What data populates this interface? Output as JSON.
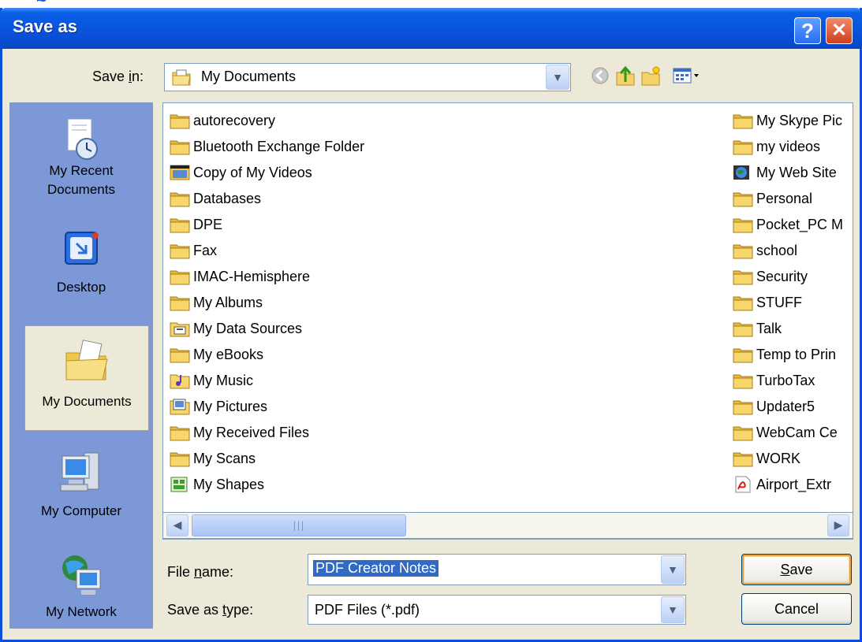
{
  "window": {
    "title": "Save as"
  },
  "toolbar": {
    "save_in_label": "Save in:",
    "save_in_value": "My Documents"
  },
  "places": [
    {
      "label": "My Recent Documents",
      "icon": "recent-documents-icon"
    },
    {
      "label": "Desktop",
      "icon": "desktop-icon"
    },
    {
      "label": "My Documents",
      "icon": "my-documents-icon",
      "selected": true
    },
    {
      "label": "My Computer",
      "icon": "my-computer-icon"
    },
    {
      "label": "My Network",
      "icon": "my-network-icon"
    }
  ],
  "files_col1": [
    {
      "name": "autorecovery",
      "icon": "folder"
    },
    {
      "name": "Bluetooth Exchange Folder",
      "icon": "folder"
    },
    {
      "name": "Copy of My Videos",
      "icon": "video-folder"
    },
    {
      "name": "Databases",
      "icon": "folder"
    },
    {
      "name": "DPE",
      "icon": "folder"
    },
    {
      "name": "Fax",
      "icon": "folder"
    },
    {
      "name": "IMAC-Hemisphere",
      "icon": "folder"
    },
    {
      "name": "My Albums",
      "icon": "folder"
    },
    {
      "name": "My Data Sources",
      "icon": "data-folder"
    },
    {
      "name": "My eBooks",
      "icon": "folder"
    },
    {
      "name": "My Music",
      "icon": "music-folder"
    },
    {
      "name": "My Pictures",
      "icon": "pictures-folder"
    },
    {
      "name": "My Received Files",
      "icon": "folder"
    },
    {
      "name": "My Scans",
      "icon": "folder"
    },
    {
      "name": "My Shapes",
      "icon": "shapes-folder"
    }
  ],
  "files_col2": [
    {
      "name": "My Skype Pic",
      "icon": "folder"
    },
    {
      "name": "my videos",
      "icon": "folder"
    },
    {
      "name": "My Web Site",
      "icon": "web-folder"
    },
    {
      "name": "Personal",
      "icon": "folder"
    },
    {
      "name": "Pocket_PC M",
      "icon": "folder"
    },
    {
      "name": "school",
      "icon": "folder"
    },
    {
      "name": "Security",
      "icon": "folder"
    },
    {
      "name": "STUFF",
      "icon": "folder"
    },
    {
      "name": "Talk",
      "icon": "folder"
    },
    {
      "name": "Temp to Prin",
      "icon": "folder"
    },
    {
      "name": "TurboTax",
      "icon": "folder"
    },
    {
      "name": "Updater5",
      "icon": "folder"
    },
    {
      "name": "WebCam Ce",
      "icon": "folder"
    },
    {
      "name": "WORK",
      "icon": "folder"
    },
    {
      "name": "Airport_Extr",
      "icon": "pdf-file"
    }
  ],
  "form": {
    "file_name_label_prefix": "File ",
    "file_name_label_u": "n",
    "file_name_label_suffix": "ame:",
    "file_name_value": "PDF Creator Notes",
    "type_label_prefix": "Save as ",
    "type_label_u": "t",
    "type_label_suffix": "ype:",
    "type_value": "PDF Files (*.pdf)"
  },
  "buttons": {
    "save_u": "S",
    "save_rest": "ave",
    "cancel": "Cancel"
  },
  "colors": {
    "title_blue": "#0a52da",
    "dialog_bg": "#ece9d8",
    "places_bg": "#7d98d6",
    "selection": "#316ac5",
    "folder_yellow": "#f5d36a"
  }
}
